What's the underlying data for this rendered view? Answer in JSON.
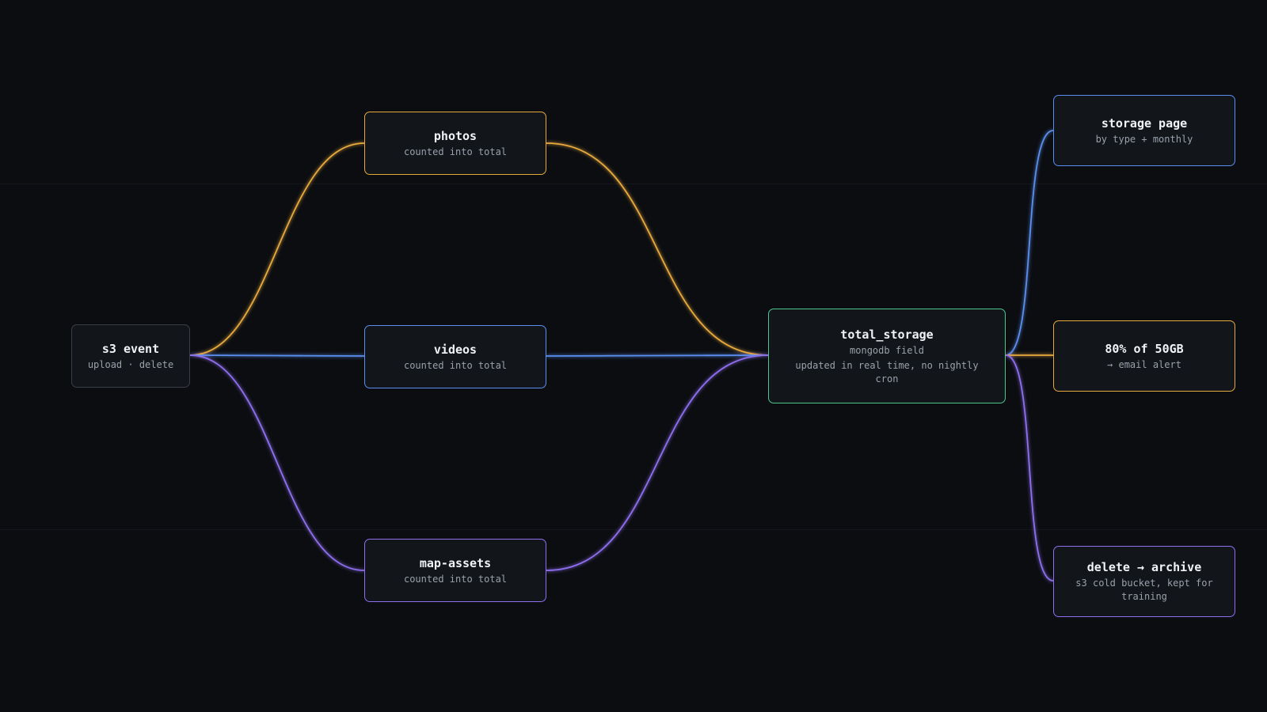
{
  "colors": {
    "background": "#0b0d11",
    "node_fill": "#12151a",
    "neutral": "#3a3f47",
    "orange": "#e8a93c",
    "blue": "#5a8ef0",
    "purple": "#8f6ef0",
    "green": "#4cc88a"
  },
  "nodes": {
    "s3_event": {
      "title": "s3 event",
      "sub": "upload · delete"
    },
    "photos": {
      "title": "photos",
      "sub": "counted into total"
    },
    "videos": {
      "title": "videos",
      "sub": "counted into total"
    },
    "map_assets": {
      "title": "map-assets",
      "sub": "counted into total"
    },
    "total_storage": {
      "title": "total_storage",
      "sub": "mongodb field",
      "sub2": "updated in real time, no nightly cron"
    },
    "storage_page": {
      "title": "storage page",
      "sub": "by type + monthly"
    },
    "alert": {
      "title": "80% of 50GB",
      "sub": "→ email alert"
    },
    "archive": {
      "title": "delete → archive",
      "sub": "s3 cold bucket, kept for training"
    }
  }
}
